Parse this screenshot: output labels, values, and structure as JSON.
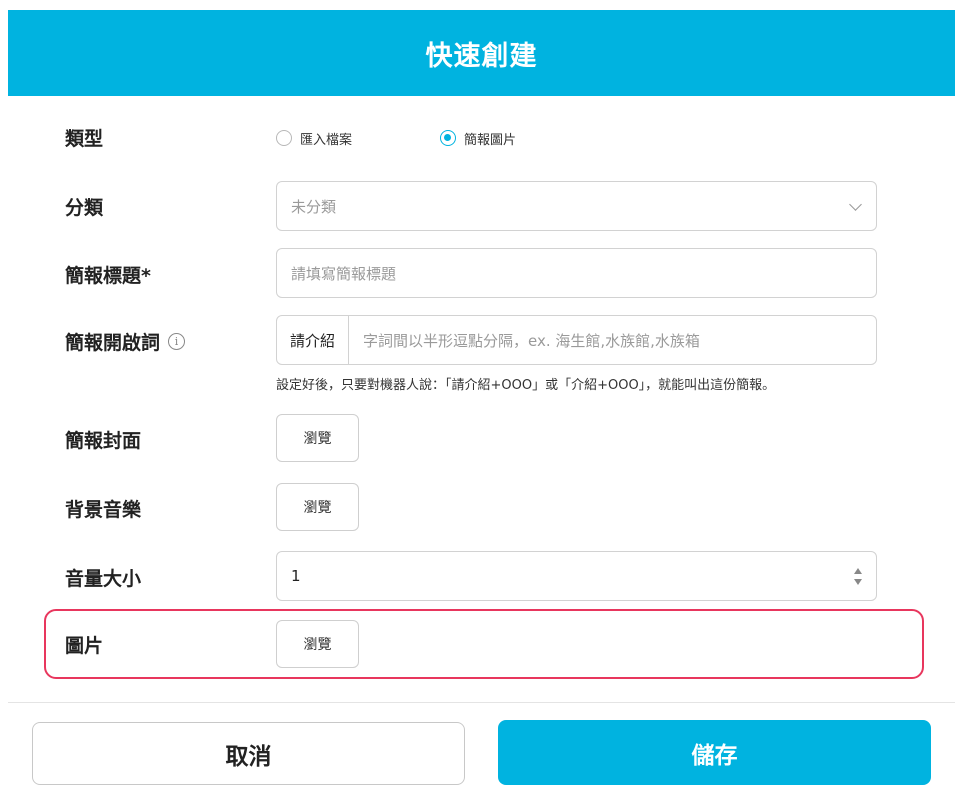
{
  "header": {
    "title": "快速創建"
  },
  "form": {
    "type": {
      "label": "類型",
      "options": [
        {
          "label": "匯入檔案",
          "checked": false
        },
        {
          "label": "簡報圖片",
          "checked": true
        }
      ]
    },
    "category": {
      "label": "分類",
      "value": "未分類"
    },
    "title": {
      "label": "簡報標題*",
      "placeholder": "請填寫簡報標題"
    },
    "keyword": {
      "label": "簡報開啟詞",
      "info_icon": "i",
      "prefix": "請介紹",
      "placeholder": "字詞間以半形逗點分隔，ex. 海生館,水族館,水族箱",
      "hint": "設定好後，只要對機器人說：「請介紹+OOO」或「介紹+OOO」，就能叫出這份簡報。"
    },
    "cover": {
      "label": "簡報封面",
      "button": "瀏覽"
    },
    "music": {
      "label": "背景音樂",
      "button": "瀏覽"
    },
    "volume": {
      "label": "音量大小",
      "value": "1"
    },
    "image": {
      "label": "圖片",
      "button": "瀏覽"
    }
  },
  "footer": {
    "cancel": "取消",
    "save": "儲存"
  },
  "colors": {
    "accent": "#00b3e0",
    "highlight": "#e8365d"
  }
}
